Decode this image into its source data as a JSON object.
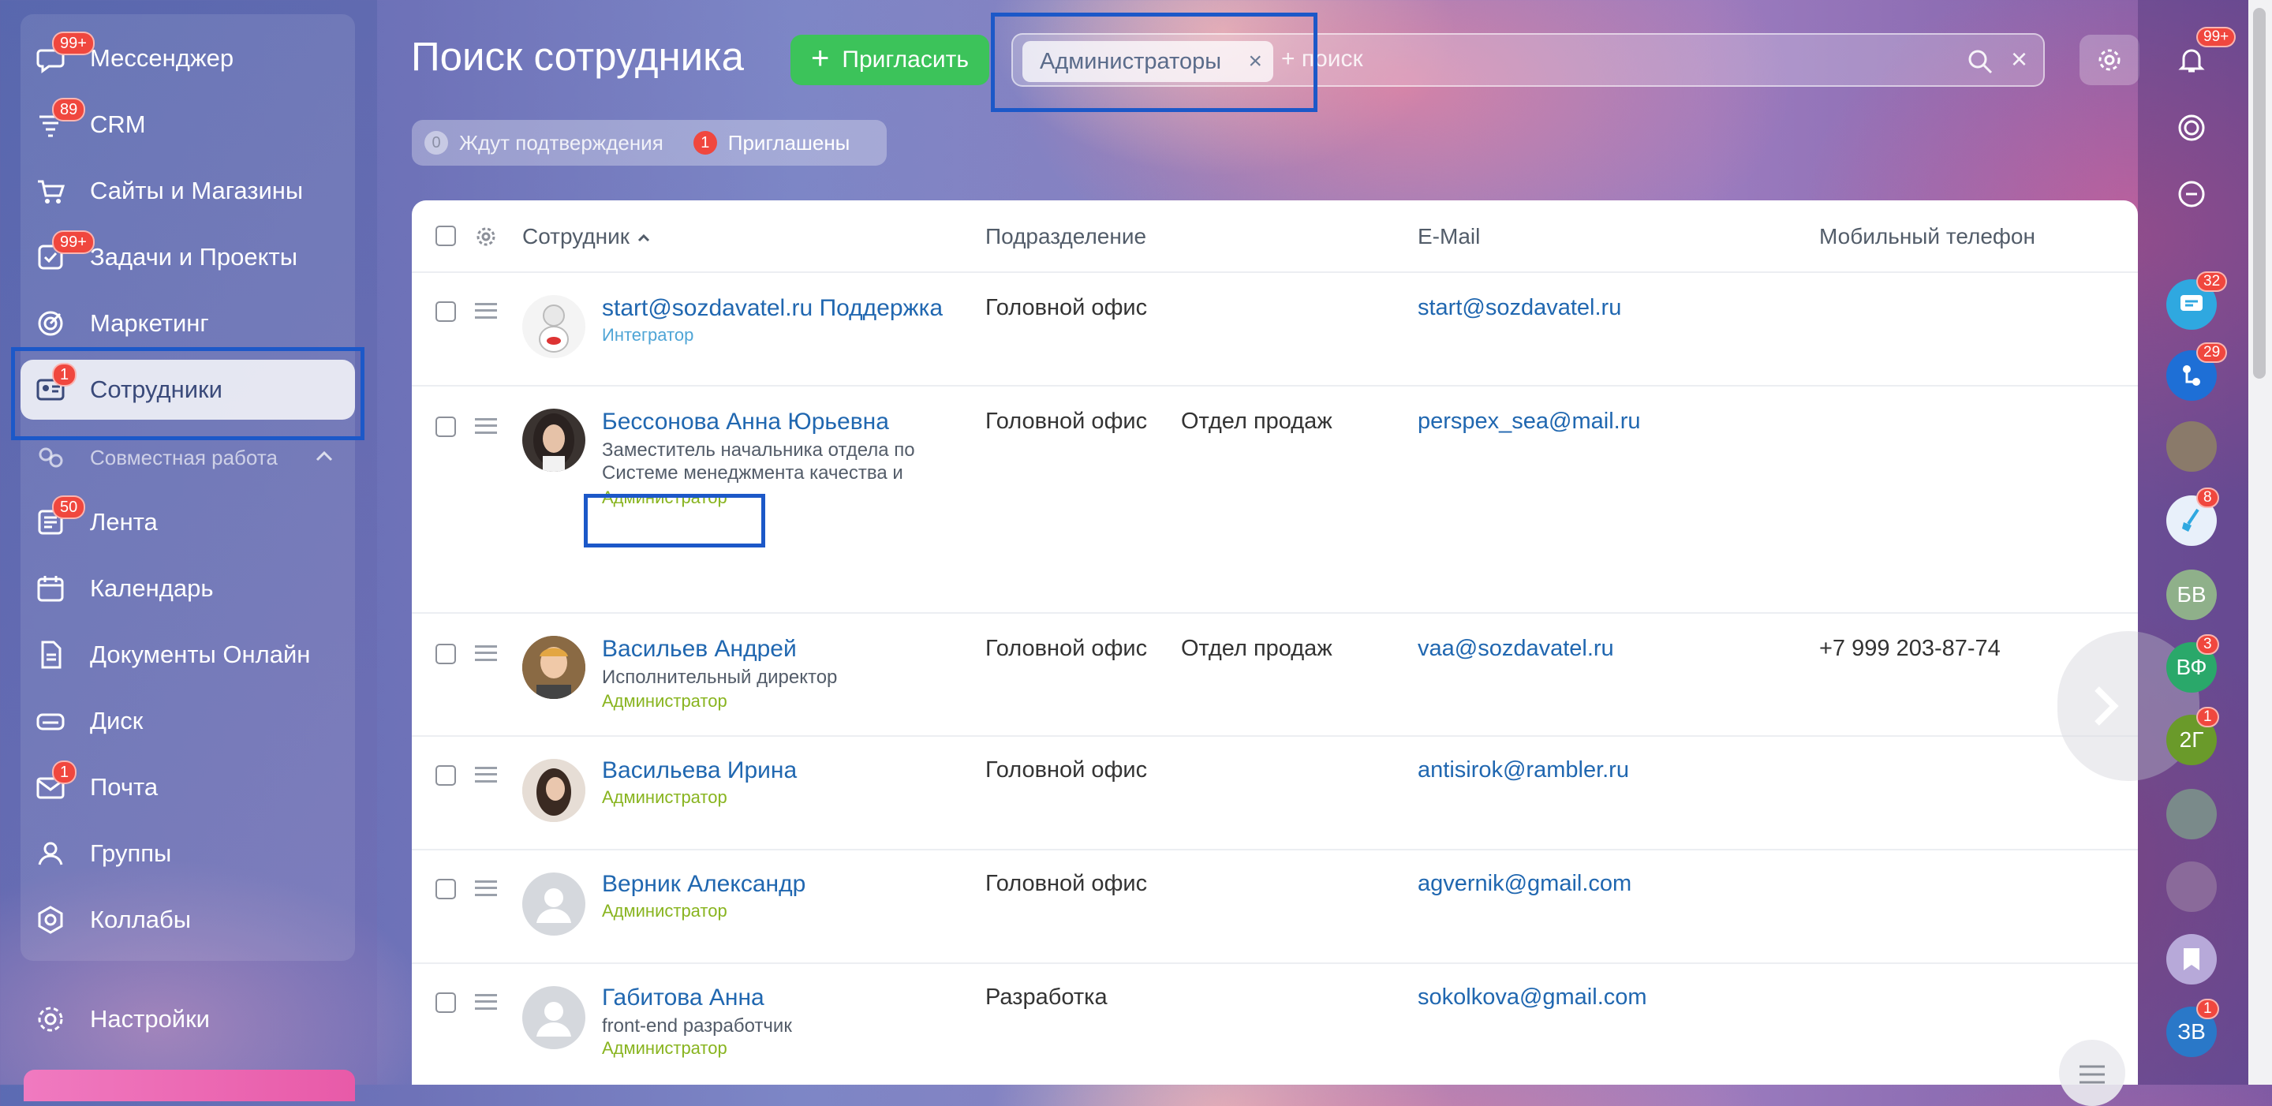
{
  "sidebar": {
    "items": [
      {
        "label": "Мессенджер",
        "icon": "messenger-icon",
        "badge": "99+"
      },
      {
        "label": "CRM",
        "icon": "crm-icon",
        "badge": "89"
      },
      {
        "label": "Сайты и Магазины",
        "icon": "cart-icon",
        "badge": ""
      },
      {
        "label": "Задачи и Проекты",
        "icon": "tasks-icon",
        "badge": "99+"
      },
      {
        "label": "Маркетинг",
        "icon": "marketing-icon",
        "badge": ""
      },
      {
        "label": "Сотрудники",
        "icon": "employees-icon",
        "badge": "1"
      },
      {
        "label": "Совместная работа",
        "icon": "collaboration-icon",
        "badge": ""
      },
      {
        "label": "Лента",
        "icon": "feed-icon",
        "badge": "50"
      },
      {
        "label": "Календарь",
        "icon": "calendar-icon",
        "badge": ""
      },
      {
        "label": "Документы Онлайн",
        "icon": "document-icon",
        "badge": ""
      },
      {
        "label": "Диск",
        "icon": "disk-icon",
        "badge": ""
      },
      {
        "label": "Почта",
        "icon": "mail-icon",
        "badge": "1"
      },
      {
        "label": "Группы",
        "icon": "groups-icon",
        "badge": ""
      },
      {
        "label": "Коллабы",
        "icon": "collabs-icon",
        "badge": ""
      }
    ],
    "settings_label": "Настройки"
  },
  "header": {
    "title": "Поиск сотрудника",
    "invite_label": "Пригласить",
    "filter_chip": "Администраторы",
    "search_placeholder": "+ поиск"
  },
  "counters": {
    "pending_count": "0",
    "pending_label": "Ждут подтверждения",
    "invited_count": "1",
    "invited_label": "Приглашены"
  },
  "table": {
    "columns": [
      "Сотрудник",
      "Подразделение",
      "E-Mail",
      "Мобильный телефон"
    ],
    "rows": [
      {
        "name": "start@sozdavatel.ru Поддержка",
        "position": "",
        "role": "Интегратор",
        "department": "Головной офис",
        "subdepartment": "",
        "email": "start@sozdavatel.ru",
        "phone": ""
      },
      {
        "name": "Бессонова Анна Юрьевна",
        "position": "Заместитель начальника отдела по Системе менеджмента качества и стандартизации",
        "role": "Администратор",
        "department": "Головной офис",
        "subdepartment": "Отдел продаж",
        "email": "perspex_sea@mail.ru",
        "phone": ""
      },
      {
        "name": "Васильев Андрей",
        "position": "Исполнительный директор",
        "role": "Администратор",
        "department": "Головной офис",
        "subdepartment": "Отдел продаж",
        "email": "vaa@sozdavatel.ru",
        "phone": "+7 999 203-87-74"
      },
      {
        "name": "Васильева Ирина",
        "position": "",
        "role": "Администратор",
        "department": "Головной офис",
        "subdepartment": "",
        "email": "antisirok@rambler.ru",
        "phone": ""
      },
      {
        "name": "Верник Александр",
        "position": "",
        "role": "Администратор",
        "department": "Головной офис",
        "subdepartment": "",
        "email": "agvernik@gmail.com",
        "phone": ""
      },
      {
        "name": "Габитова Анна",
        "position": "front-end разработчик",
        "role": "Администратор",
        "department": "Разработка",
        "subdepartment": "",
        "email": "sokolkova@gmail.com",
        "phone": ""
      }
    ]
  },
  "rightbar": {
    "notifications_badge": "99+",
    "items": [
      {
        "initials": "",
        "badge": "32"
      },
      {
        "initials": "",
        "badge": "29"
      },
      {
        "initials": "",
        "badge": ""
      },
      {
        "initials": "",
        "badge": "8"
      },
      {
        "initials": "БВ",
        "badge": ""
      },
      {
        "initials": "ВФ",
        "badge": "3"
      },
      {
        "initials": "2Г",
        "badge": "1"
      },
      {
        "initials": "",
        "badge": ""
      },
      {
        "initials": "",
        "badge": ""
      },
      {
        "initials": "",
        "badge": ""
      },
      {
        "initials": "ЗВ",
        "badge": "1"
      }
    ]
  },
  "colors": {
    "accent_green": "#3cc35a",
    "link_blue": "#2067b0",
    "badge_red": "#f0473e",
    "admin_green": "#88b41f",
    "highlight_blue": "#1c58c8"
  }
}
